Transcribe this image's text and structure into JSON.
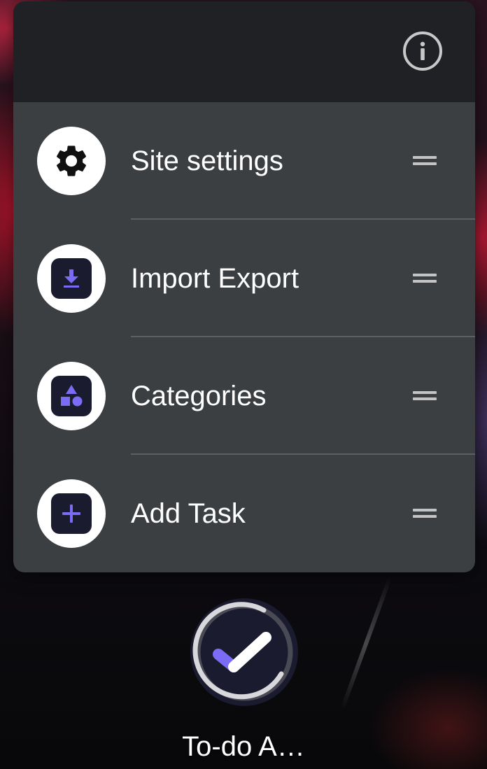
{
  "popup": {
    "info_icon": "info-icon",
    "shortcuts": [
      {
        "label": "Site settings",
        "icon": "gear-icon"
      },
      {
        "label": "Import Export",
        "icon": "download-icon"
      },
      {
        "label": "Categories",
        "icon": "shapes-icon"
      },
      {
        "label": "Add Task",
        "icon": "plus-icon"
      }
    ],
    "drag_handle_icon": "drag-handle-icon"
  },
  "app": {
    "label": "To-do A…",
    "icon": "checkmark-icon"
  },
  "colors": {
    "popup_bg": "#3c3f42",
    "header_bg": "#202124",
    "accent": "#7b6cf6",
    "app_square_bg": "#1b1b2f"
  }
}
